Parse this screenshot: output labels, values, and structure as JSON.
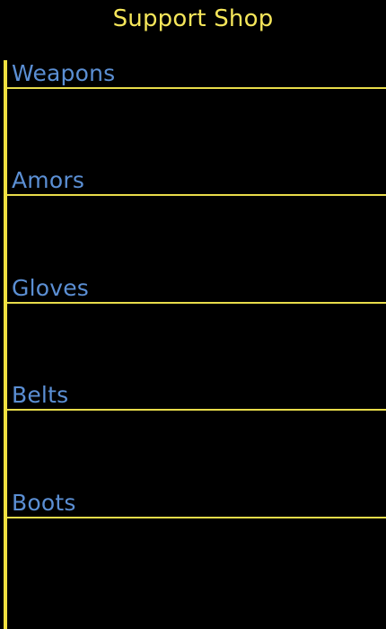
{
  "header": {
    "title": "Support Shop"
  },
  "colors": {
    "background": "#000000",
    "title": "#f5e65a",
    "accent_line": "#e8dc4a",
    "category_text": "#5b8fd4"
  },
  "categories": [
    {
      "label": "Weapons"
    },
    {
      "label": "Amors"
    },
    {
      "label": "Gloves"
    },
    {
      "label": "Belts"
    },
    {
      "label": "Boots"
    }
  ]
}
